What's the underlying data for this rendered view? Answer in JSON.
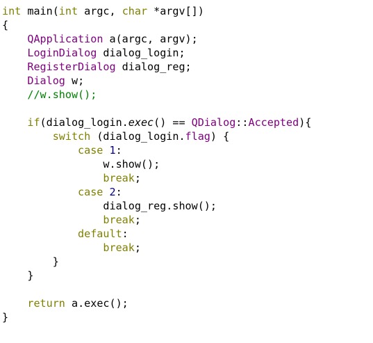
{
  "editor": {
    "colors": {
      "plain": "#000000",
      "keyword": "#808000",
      "type": "#800080",
      "comment": "#008000",
      "number": "#000080"
    },
    "lines": [
      [
        {
          "t": "int",
          "c": "kw"
        },
        {
          "t": " main(",
          "c": "plain"
        },
        {
          "t": "int",
          "c": "kw"
        },
        {
          "t": " argc, ",
          "c": "plain"
        },
        {
          "t": "char",
          "c": "kw"
        },
        {
          "t": " *argv[])",
          "c": "plain"
        }
      ],
      [
        {
          "t": "{",
          "c": "plain"
        }
      ],
      [
        {
          "t": "    ",
          "c": "plain"
        },
        {
          "t": "QApplication",
          "c": "type"
        },
        {
          "t": " a(argc, argv);",
          "c": "plain"
        }
      ],
      [
        {
          "t": "    ",
          "c": "plain"
        },
        {
          "t": "LoginDialog",
          "c": "type"
        },
        {
          "t": " dialog_login;",
          "c": "plain"
        }
      ],
      [
        {
          "t": "    ",
          "c": "plain"
        },
        {
          "t": "RegisterDialog",
          "c": "type"
        },
        {
          "t": " dialog_reg;",
          "c": "plain"
        }
      ],
      [
        {
          "t": "    ",
          "c": "plain"
        },
        {
          "t": "Dialog",
          "c": "type"
        },
        {
          "t": " w;",
          "c": "plain"
        }
      ],
      [
        {
          "t": "    ",
          "c": "plain"
        },
        {
          "t": "//w.show();",
          "c": "cmt"
        }
      ],
      [],
      [
        {
          "t": "    ",
          "c": "plain"
        },
        {
          "t": "if",
          "c": "kw"
        },
        {
          "t": "(dialog_login.",
          "c": "plain"
        },
        {
          "t": "exec",
          "c": "plain",
          "i": true
        },
        {
          "t": "() == ",
          "c": "plain"
        },
        {
          "t": "QDialog",
          "c": "type"
        },
        {
          "t": "::",
          "c": "plain"
        },
        {
          "t": "Accepted",
          "c": "type"
        },
        {
          "t": "){",
          "c": "plain"
        }
      ],
      [
        {
          "t": "        ",
          "c": "plain"
        },
        {
          "t": "switch",
          "c": "kw"
        },
        {
          "t": " (dialog_login.",
          "c": "plain"
        },
        {
          "t": "flag",
          "c": "type"
        },
        {
          "t": ") {",
          "c": "plain"
        }
      ],
      [
        {
          "t": "            ",
          "c": "plain"
        },
        {
          "t": "case",
          "c": "kw"
        },
        {
          "t": " ",
          "c": "plain"
        },
        {
          "t": "1",
          "c": "num"
        },
        {
          "t": ":",
          "c": "plain"
        }
      ],
      [
        {
          "t": "                w.show();",
          "c": "plain"
        }
      ],
      [
        {
          "t": "                ",
          "c": "plain"
        },
        {
          "t": "break",
          "c": "kw"
        },
        {
          "t": ";",
          "c": "plain"
        }
      ],
      [
        {
          "t": "            ",
          "c": "plain"
        },
        {
          "t": "case",
          "c": "kw"
        },
        {
          "t": " ",
          "c": "plain"
        },
        {
          "t": "2",
          "c": "num"
        },
        {
          "t": ":",
          "c": "plain"
        }
      ],
      [
        {
          "t": "                dialog_reg.show();",
          "c": "plain"
        }
      ],
      [
        {
          "t": "                ",
          "c": "plain"
        },
        {
          "t": "break",
          "c": "kw"
        },
        {
          "t": ";",
          "c": "plain"
        }
      ],
      [
        {
          "t": "            ",
          "c": "plain"
        },
        {
          "t": "default",
          "c": "kw"
        },
        {
          "t": ":",
          "c": "plain"
        }
      ],
      [
        {
          "t": "                ",
          "c": "plain"
        },
        {
          "t": "break",
          "c": "kw"
        },
        {
          "t": ";",
          "c": "plain"
        }
      ],
      [
        {
          "t": "        }",
          "c": "plain"
        }
      ],
      [
        {
          "t": "    }",
          "c": "plain"
        }
      ],
      [],
      [
        {
          "t": "    ",
          "c": "plain"
        },
        {
          "t": "return",
          "c": "kw"
        },
        {
          "t": " a.exec();",
          "c": "plain"
        }
      ],
      [
        {
          "t": "}",
          "c": "plain"
        }
      ]
    ]
  }
}
